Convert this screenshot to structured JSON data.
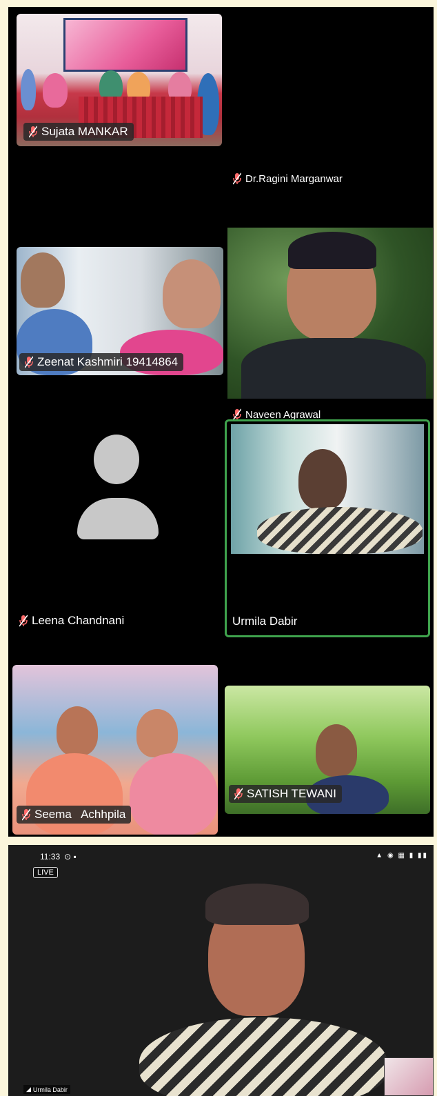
{
  "screenshot1": {
    "participants": [
      {
        "name": "Sujata MANKAR"
      },
      {
        "name": "Dr.Ragini Marganwar"
      },
      {
        "name": "Zeenat Kashmiri 19414864"
      },
      {
        "name": "Naveen Agrawal"
      }
    ]
  },
  "screenshot2": {
    "participants": [
      {
        "name": "Leena Chandnani"
      },
      {
        "name": "Urmila Dabir"
      },
      {
        "name": "Seema   Achhpila"
      },
      {
        "name": "SATISH TEWANI"
      }
    ],
    "active_speaker_color": "#3fa34d"
  },
  "screenshot3": {
    "status_time": "11:33",
    "live_label": "LIVE",
    "speaker_name": "Urmila Dabir"
  },
  "icons": {
    "muted_mic": "mic-muted-icon",
    "avatar": "avatar-placeholder-icon"
  },
  "colors": {
    "background": "#fbf6dc",
    "panel": "#000000",
    "muted_mic": "#ff6b6b"
  }
}
